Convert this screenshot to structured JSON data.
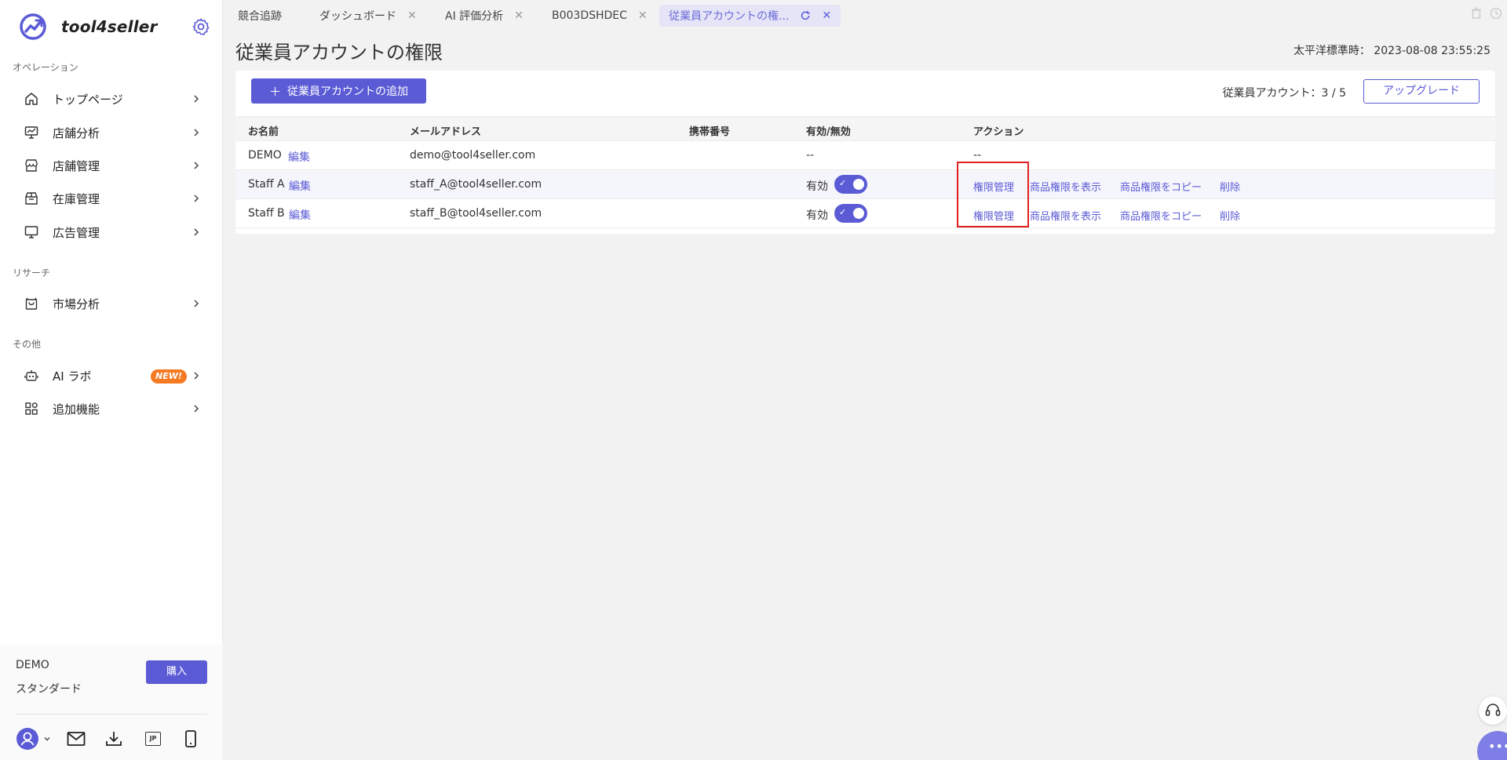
{
  "sidebar": {
    "brand": "tool4seller",
    "sections": {
      "operations": "オペレーション",
      "research": "リサーチ",
      "other": "その他"
    },
    "items": [
      {
        "label": "トップページ"
      },
      {
        "label": "店舗分析"
      },
      {
        "label": "店舗管理"
      },
      {
        "label": "在庫管理"
      },
      {
        "label": "広告管理"
      },
      {
        "label": "市場分析"
      },
      {
        "label": "AI ラボ",
        "badge": "NEW!"
      },
      {
        "label": "追加機能"
      }
    ],
    "footer": {
      "account": "DEMO",
      "plan": "スタンダード",
      "buy_label": "購入",
      "lang_code": "JP"
    }
  },
  "tabs": [
    {
      "label": "競合追跡"
    },
    {
      "label": "ダッシュボード"
    },
    {
      "label": "AI 評価分析"
    },
    {
      "label": "B003DSHDEC"
    },
    {
      "label": "従業員アカウントの権..."
    }
  ],
  "page": {
    "title": "従業員アカウントの権限",
    "timezone": "太平洋標準時： 2023-08-08 23:55:25",
    "add_button": "従業員アカウントの追加",
    "account_count": "従業員アカウント：3 / 5",
    "upgrade_button": "アップグレード"
  },
  "table": {
    "columns": [
      "お名前",
      "メールアドレス",
      "携帯番号",
      "有効/無効",
      "アクション"
    ],
    "edit_label": "編集",
    "enabled_label": "有効",
    "rows": [
      {
        "name": "DEMO",
        "email": "demo@tool4seller.com",
        "phone": "",
        "status": "--",
        "actions": "--"
      },
      {
        "name": "Staff A",
        "email": "staff_A@tool4seller.com",
        "phone": "",
        "status": "有効",
        "enabled": true
      },
      {
        "name": "Staff B",
        "email": "staff_B@tool4seller.com",
        "phone": "",
        "status": "有効",
        "enabled": true
      }
    ],
    "action_labels": {
      "permissions": "権限管理",
      "view_products": "商品権限を表示",
      "copy_products": "商品権限をコピー",
      "delete": "削除"
    }
  },
  "colors": {
    "accent": "#5b5bd6",
    "highlight_box": "#e02020",
    "badge": "#f57a22"
  }
}
